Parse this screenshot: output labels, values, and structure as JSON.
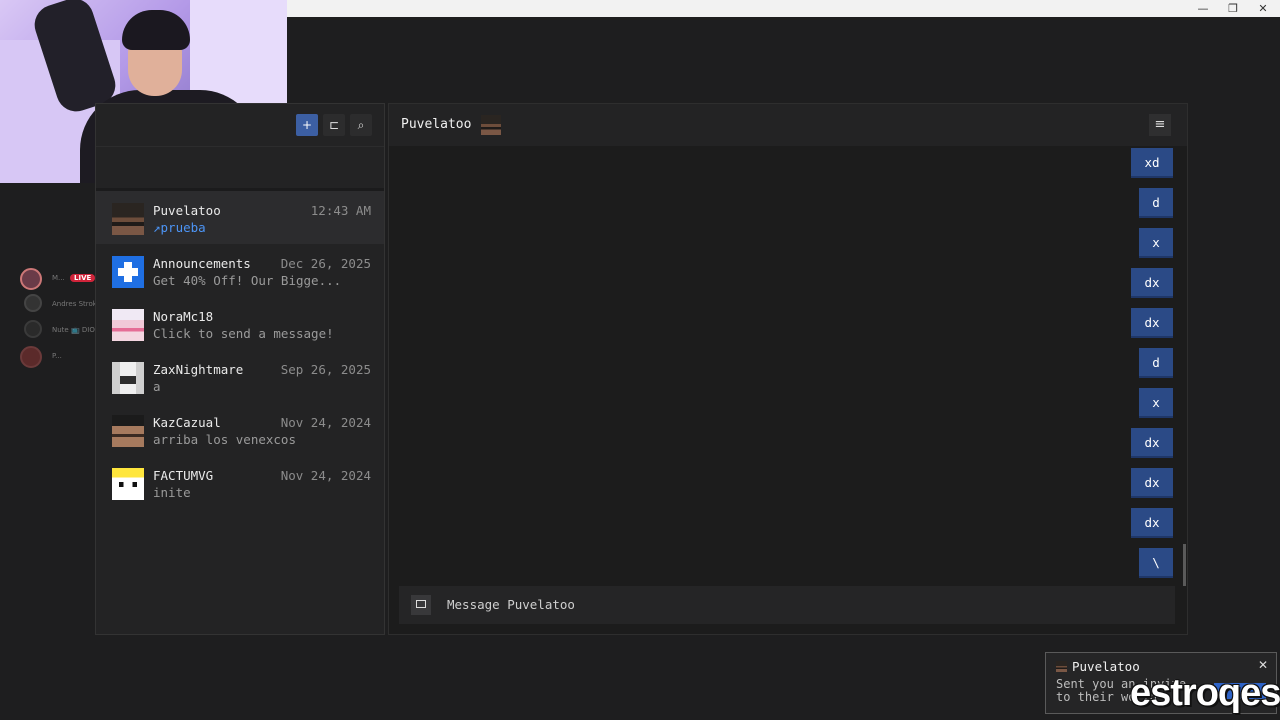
{
  "window": {
    "minimize": "—",
    "maximize": "❐",
    "close": "✕"
  },
  "mini_list": {
    "items": [
      {
        "text": "M...",
        "live": "LIVE"
      },
      {
        "text": "Andres Strokes J..."
      },
      {
        "text": "Nute  📺 DIOS"
      },
      {
        "text": "P..."
      }
    ]
  },
  "friends_panel": {
    "header_buttons": [
      {
        "icon": "add-friend-icon",
        "glyph": "+"
      },
      {
        "icon": "new-group-icon",
        "glyph": "⊏"
      },
      {
        "icon": "search-icon",
        "glyph": "⌕"
      }
    ],
    "conversations": [
      {
        "name": "Puvelatoo",
        "time": "12:43 AM",
        "preview": "↗prueba",
        "active": true,
        "link": true,
        "avatar": "puvelatoo-avatar"
      },
      {
        "name": "Announcements",
        "time": "Dec 26, 2025",
        "preview": "Get 40% Off! Our Bigge...",
        "avatar": "announcements-avatar"
      },
      {
        "name": "NoraMc18",
        "time": "",
        "preview": "Click to send a message!",
        "avatar": "noramc18-avatar"
      },
      {
        "name": "ZaxNightmare",
        "time": "Sep 26, 2025",
        "preview": "a",
        "avatar": "zaxnightmare-avatar"
      },
      {
        "name": "KazCazual",
        "time": "Nov 24, 2024",
        "preview": "arriba los venexcos",
        "avatar": "kazcazual-avatar"
      },
      {
        "name": "FACTUMVG",
        "time": "Nov 24, 2024",
        "preview": "inite",
        "avatar": "factumvg-avatar"
      }
    ]
  },
  "chat": {
    "title": "Puvelatoo",
    "menu_glyph": "≡",
    "messages": [
      "xd",
      "d",
      "x",
      "dx",
      "dx",
      "d",
      "x",
      "dx",
      "dx",
      "dx",
      "\\"
    ],
    "composer_placeholder": "Message Puvelatoo"
  },
  "toast": {
    "title": "Puvelatoo",
    "body": "Sent you an invite to their world",
    "close": "✕"
  },
  "watermark": "estroqes"
}
